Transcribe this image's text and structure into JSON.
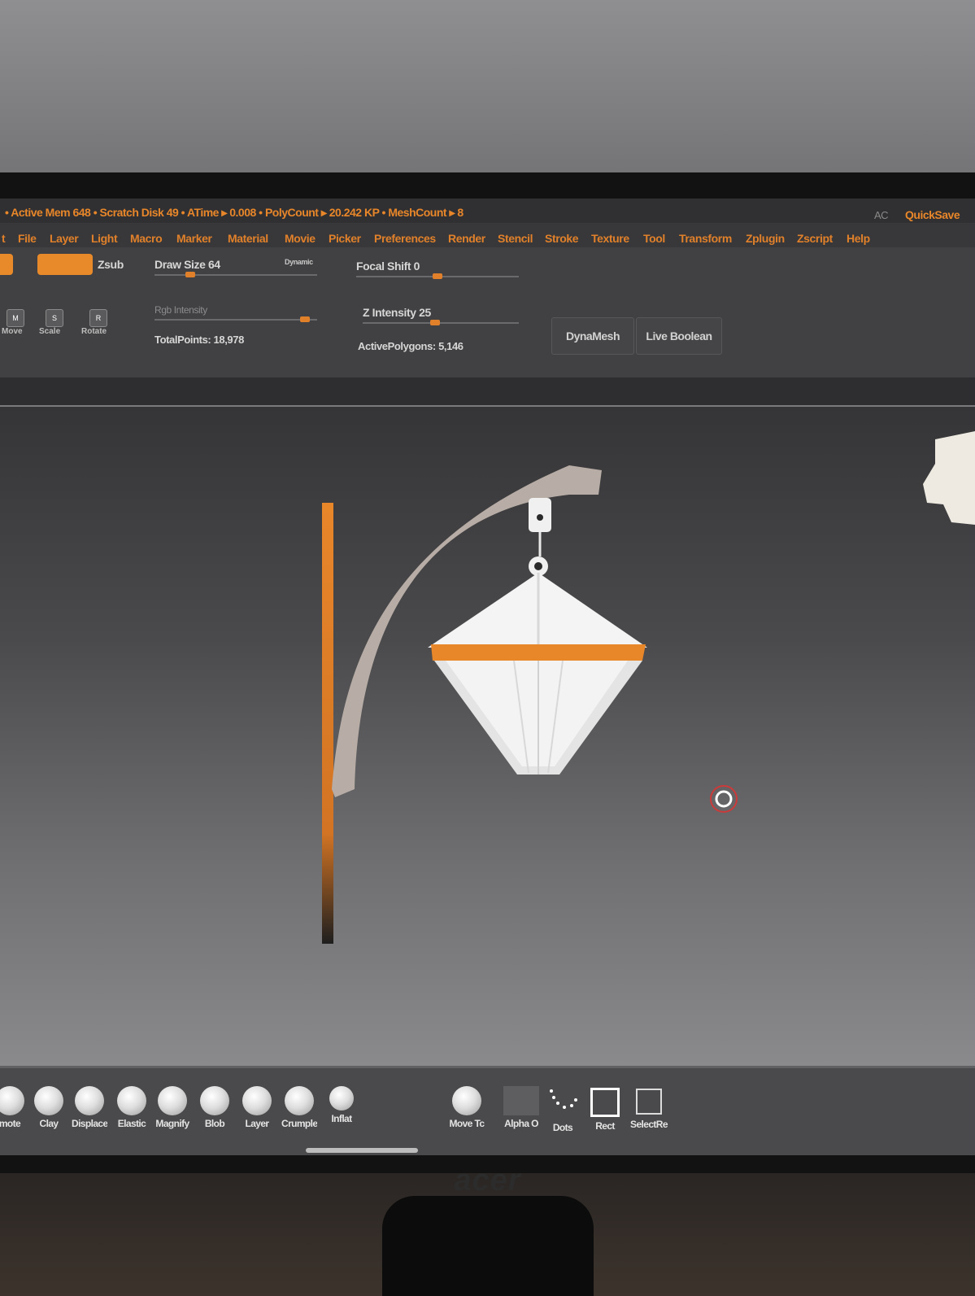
{
  "status": {
    "info": "• Active Mem 648 • Scratch Disk 49 • ATime ▸ 0.008 • PolyCount ▸ 20.242 KP • MeshCount ▸ 8",
    "ac": "AC",
    "quicksave": "QuickSave"
  },
  "menu": [
    "t",
    "File",
    "Layer",
    "Light",
    "Macro",
    "Marker",
    "Material",
    "Movie",
    "Picker",
    "Preferences",
    "Render",
    "Stencil",
    "Stroke",
    "Texture",
    "Tool",
    "Transform",
    "Zplugin",
    "Zscript",
    "Help"
  ],
  "toolbar": {
    "zsub": "Zsub",
    "draw_size": "Draw Size 64",
    "draw_size_value": 0.2,
    "dynamic": "Dynamic",
    "focal_shift": "Focal Shift 0",
    "focal_shift_value": 0.5,
    "rgb_intensity": "Rgb Intensity",
    "rgb_intensity_value": 0.95,
    "z_intensity": "Z Intensity 25",
    "z_intensity_value": 0.46,
    "total_points": "TotalPoints: 18,978",
    "active_polygons": "ActivePolygons: 5,146",
    "dynamesh": "DynaMesh",
    "live_boolean": "Live Boolean",
    "icons": [
      {
        "glyph": "M",
        "label": "Move"
      },
      {
        "glyph": "S",
        "label": "Scale"
      },
      {
        "glyph": "R",
        "label": "Rotate"
      }
    ]
  },
  "brushes": [
    "mote",
    "Clay",
    "Displace",
    "Elastic",
    "Magnify",
    "Blob",
    "Layer",
    "Crumple",
    "Inflat"
  ],
  "tools": [
    "Move Tc",
    "Alpha O",
    "Dots",
    "Rect",
    "SelectRe"
  ],
  "monitor_brand": "acer",
  "colors": {
    "accent": "#e88a2a",
    "model_white": "#f2f2f2",
    "model_arm": "#b8ada6"
  }
}
